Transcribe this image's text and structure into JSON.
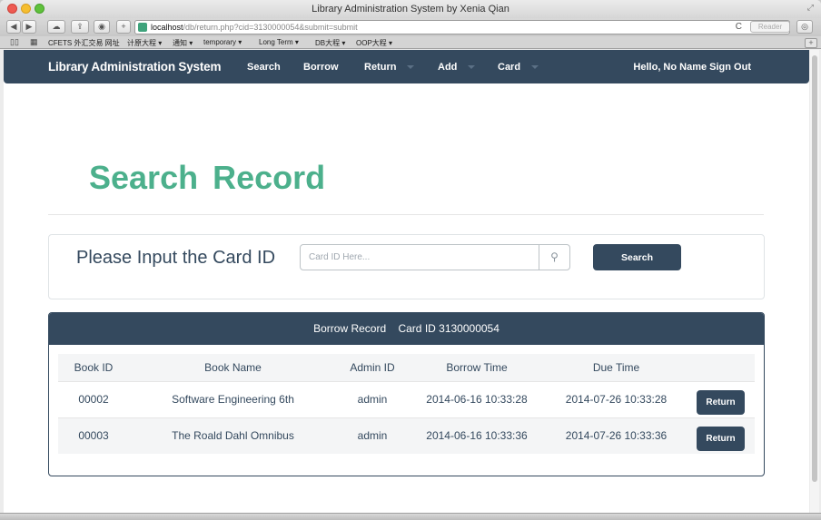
{
  "browser": {
    "window_title": "Library Administration System by Xenia Qian",
    "url_host": "localhost",
    "url_path": "/db/return.php?cid=3130000054&submit=submit",
    "reader_label": "Reader",
    "bookmarks": [
      "CFETS 外汇交易 网址",
      "计原大程 ▾",
      "通知 ▾",
      "temporary ▾",
      "Long Term ▾",
      "DB大程 ▾",
      "OOP大程 ▾"
    ]
  },
  "navbar": {
    "brand": "Library Administration System",
    "items": [
      {
        "label": "Search"
      },
      {
        "label": "Borrow"
      },
      {
        "label": "Return"
      },
      {
        "label": "Add"
      },
      {
        "label": "Card"
      }
    ],
    "user_text": "Hello, No Name  Sign Out"
  },
  "page": {
    "title": "Search  Record"
  },
  "search": {
    "label": "Please Input the Card ID",
    "placeholder": "Card ID Here...",
    "value": "",
    "button_label": "Search"
  },
  "record": {
    "heading_left": "Borrow Record",
    "heading_right": "Card ID 3130000054",
    "columns": [
      "Book ID",
      "Book Name",
      "Admin ID",
      "Borrow Time",
      "Due Time",
      ""
    ],
    "rows": [
      {
        "book_id": "00002",
        "book_name": "Software Engineering 6th",
        "admin_id": "admin",
        "borrow_time": "2014-06-16 10:33:28",
        "due_time": "2014-07-26 10:33:28",
        "action": "Return"
      },
      {
        "book_id": "00003",
        "book_name": "The Roald Dahl Omnibus",
        "admin_id": "admin",
        "borrow_time": "2014-06-16 10:33:36",
        "due_time": "2014-07-26 10:33:36",
        "action": "Return"
      }
    ]
  },
  "colors": {
    "navbar": "#34495e",
    "title_green": "#4cb08c",
    "button": "#34495e"
  }
}
